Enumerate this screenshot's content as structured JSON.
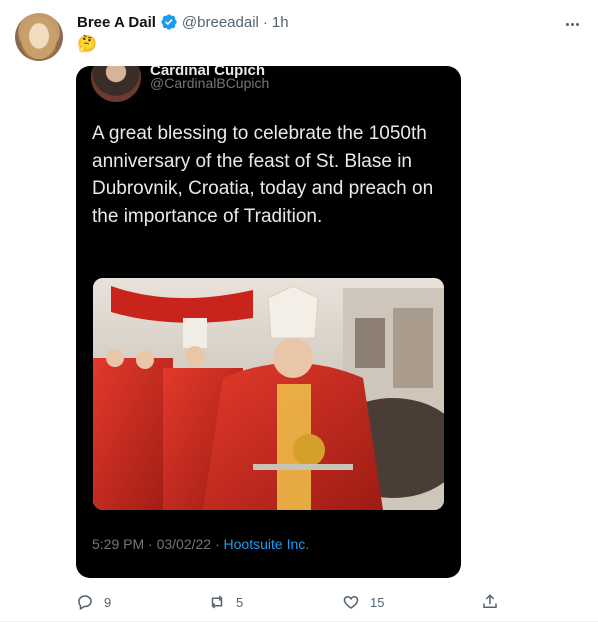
{
  "author": {
    "name": "Bree A Dail",
    "handle": "@breeadail",
    "separator": "·",
    "time": "1h"
  },
  "tweet_emoji": "🤔",
  "quoted": {
    "author_name": "Cardinal Cupich",
    "author_handle": "@CardinalBCupich",
    "text": "A great blessing to celebrate the 1050th anniversary of the feast of St. Blase in Dubrovnik, Croatia, today and preach on the importance of Tradition.",
    "timestamp": "5:29 PM · 03/02/22 · ",
    "source": "Hootsuite Inc."
  },
  "actions": {
    "reply_count": "9",
    "retweet_count": "5",
    "like_count": "15"
  },
  "colors": {
    "brand": "#1d9bf0",
    "muted": "#536471",
    "card_bg": "#000000"
  },
  "icons": [
    "verified-icon",
    "more-icon",
    "reply-icon",
    "retweet-icon",
    "like-icon",
    "share-icon"
  ]
}
